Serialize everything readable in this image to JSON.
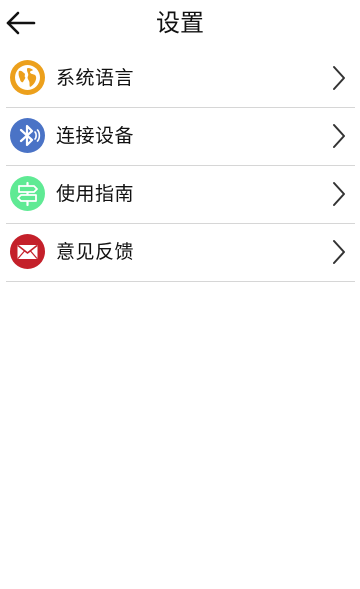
{
  "header": {
    "title": "设置",
    "back_icon": "arrow-left-icon"
  },
  "menu": {
    "items": [
      {
        "label": "系统语言",
        "icon": "globe-icon",
        "color": "#ECA01C"
      },
      {
        "label": "连接设备",
        "icon": "bluetooth-icon",
        "color": "#4A73C6"
      },
      {
        "label": "使用指南",
        "icon": "signpost-icon",
        "color": "#5FEA94"
      },
      {
        "label": "意见反馈",
        "icon": "envelope-icon",
        "color": "#C4202A"
      }
    ],
    "chevron_icon": "chevron-right-icon"
  }
}
